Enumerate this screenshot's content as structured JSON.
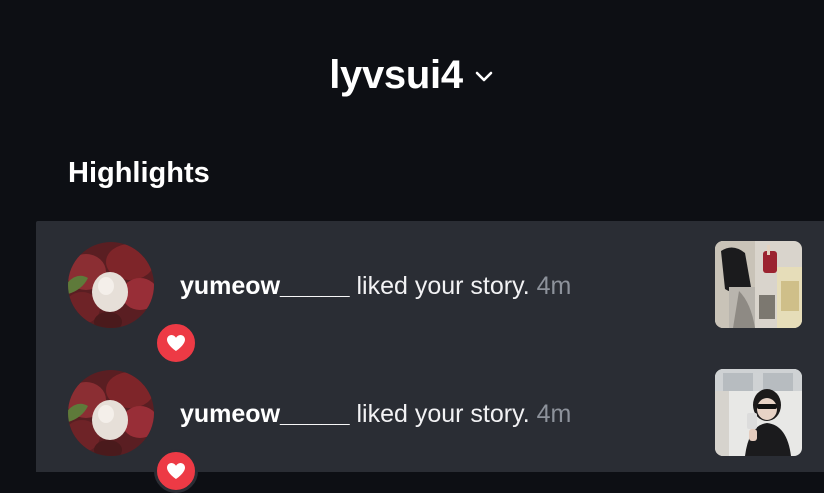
{
  "header": {
    "username": "lyvsui4",
    "chevron_icon": "chevron-down-icon"
  },
  "section": {
    "title": "Highlights"
  },
  "notifications": [
    {
      "username": "yumeow_____",
      "action": " liked your story. ",
      "time": "4m",
      "badge_icon": "heart-icon",
      "badge_color": "#ed3a45"
    },
    {
      "username": "yumeow_____",
      "action": " liked your story. ",
      "time": "4m",
      "badge_icon": "heart-icon",
      "badge_color": "#ed3a45"
    }
  ],
  "colors": {
    "background": "#0d0f14",
    "list_background": "#2a2d34",
    "muted_text": "#8d929b"
  }
}
